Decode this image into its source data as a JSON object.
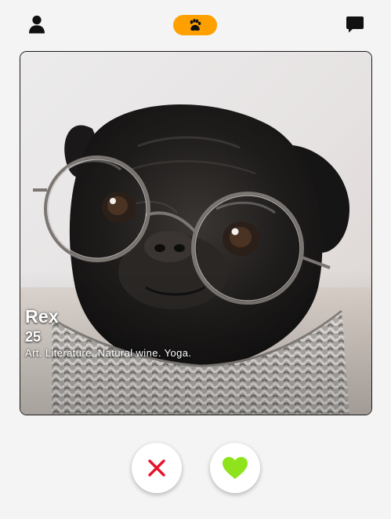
{
  "colors": {
    "background": "#f4f4f4",
    "accent": "#ffa000",
    "nope": "#e8132a",
    "like": "#8fe31c",
    "icon_dark": "#111111"
  },
  "nav": {
    "profile_icon": "person-icon",
    "paw_icon": "paw-icon",
    "chat_icon": "chat-bubble-icon"
  },
  "profile": {
    "name": "Rex",
    "age": "25",
    "bio": "Art. Literature. Natural wine. Yoga.",
    "photo_subject": "black pug wearing round glasses and knit scarf"
  },
  "actions": {
    "nope_icon": "close-icon",
    "like_icon": "heart-icon"
  }
}
